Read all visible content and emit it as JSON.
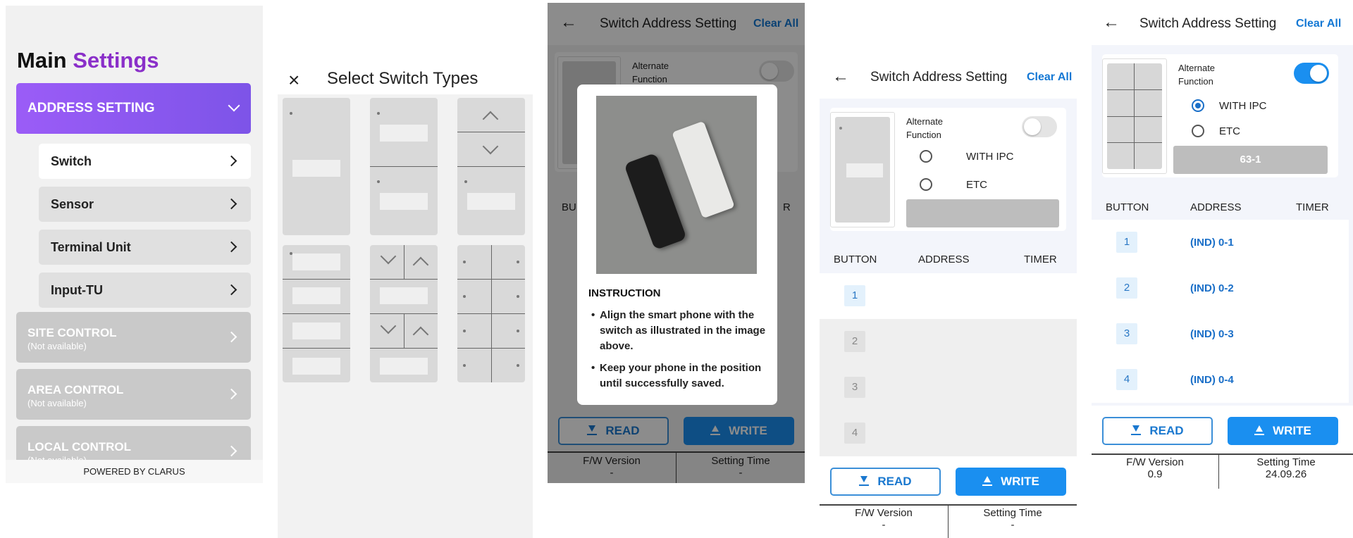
{
  "main_settings": {
    "title_main": "Main",
    "title_accent": "Settings",
    "address_setting": "ADDRESS SETTING",
    "sub_items": [
      "Switch",
      "Sensor",
      "Terminal Unit",
      "Input-TU"
    ],
    "disabled_items": [
      {
        "label": "SITE CONTROL",
        "note": "(Not available)"
      },
      {
        "label": "AREA CONTROL",
        "note": "(Not available)"
      },
      {
        "label": "LOCAL CONTROL",
        "note": "(Not available)"
      }
    ],
    "footer": "POWERED BY CLARUS"
  },
  "select_switch": {
    "title": "Select Switch Types",
    "close_icon": "×"
  },
  "screen3": {
    "title": "Switch Address Setting",
    "clear_all": "Clear All",
    "alt_function": "Alternate\nFunction",
    "col_button": "BU",
    "col_timer": "R",
    "instruction_title": "INSTRUCTION",
    "instructions": [
      "Align the smart phone with the switch as illustrated in the image above.",
      "Keep your phone in the position until successfully saved."
    ],
    "read": "READ",
    "write": "WRITE",
    "fw_label": "F/W Version",
    "fw_value": "-",
    "time_label": "Setting Time",
    "time_value": "-"
  },
  "screen4": {
    "title": "Switch Address Setting",
    "clear_all": "Clear All",
    "alt_function": "Alternate\nFunction",
    "radio_ipc": "WITH IPC",
    "radio_etc": "ETC",
    "col_button": "BUTTON",
    "col_address": "ADDRESS",
    "col_timer": "TIMER",
    "rows": [
      "1",
      "2",
      "3",
      "4"
    ],
    "read": "READ",
    "write": "WRITE",
    "fw_label": "F/W Version",
    "fw_value": "-",
    "time_label": "Setting Time",
    "time_value": "-"
  },
  "screen5": {
    "title": "Switch Address Setting",
    "clear_all": "Clear All",
    "alt_function": "Alternate\nFunction",
    "radio_ipc": "WITH IPC",
    "radio_etc": "ETC",
    "field_value": "63-1",
    "col_button": "BUTTON",
    "col_address": "ADDRESS",
    "col_timer": "TIMER",
    "rows": [
      {
        "n": "1",
        "addr": "(IND) 0-1"
      },
      {
        "n": "2",
        "addr": "(IND) 0-2"
      },
      {
        "n": "3",
        "addr": "(IND) 0-3"
      },
      {
        "n": "4",
        "addr": "(IND) 0-4"
      }
    ],
    "read": "READ",
    "write": "WRITE",
    "fw_label": "F/W Version",
    "fw_value": "0.9",
    "time_label": "Setting Time",
    "time_value": "24.09.26"
  },
  "colors": {
    "accent_purple": "#8a2fc9",
    "primary_blue": "#1a8ff0",
    "link_blue": "#1478d4"
  }
}
